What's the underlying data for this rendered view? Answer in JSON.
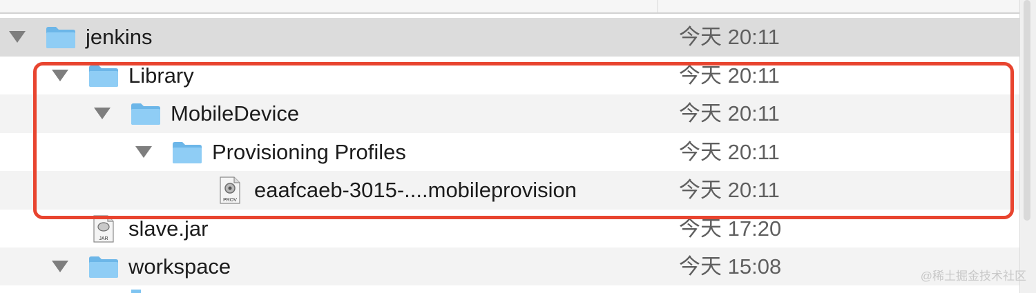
{
  "rows": [
    {
      "name": "jenkins",
      "date": "今天 20:11",
      "kind": "folder"
    },
    {
      "name": "Library",
      "date": "今天 20:11",
      "kind": "folder"
    },
    {
      "name": "MobileDevice",
      "date": "今天 20:11",
      "kind": "folder"
    },
    {
      "name": "Provisioning Profiles",
      "date": "今天 20:11",
      "kind": "folder"
    },
    {
      "name": "eaafcaeb-3015-....mobileprovision",
      "date": "今天 20:11",
      "kind": "mobileprovision",
      "icon_label": "PROV"
    },
    {
      "name": "slave.jar",
      "date": "今天 17:20",
      "kind": "jar",
      "icon_label": "JAR"
    },
    {
      "name": "workspace",
      "date": "今天 15:08",
      "kind": "folder"
    }
  ],
  "watermark": "@稀土掘金技术社区",
  "colors": {
    "highlight": "#e8442f",
    "folder": "#7fc4f1",
    "selected_row": "#dcdcdc"
  }
}
